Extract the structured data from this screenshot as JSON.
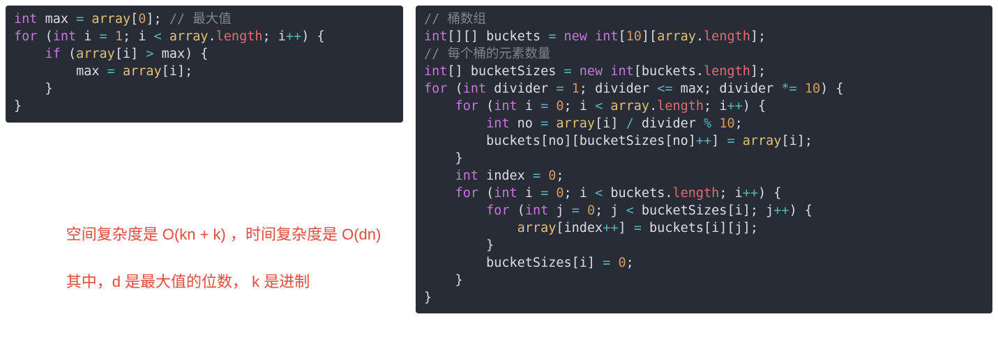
{
  "left_code": {
    "tokens": [
      [
        [
          "kw",
          "int "
        ],
        [
          "white",
          "max "
        ],
        [
          "op",
          "="
        ],
        [
          "white",
          " "
        ],
        [
          "call",
          "array"
        ],
        [
          "punc",
          "["
        ],
        [
          "num",
          "0"
        ],
        [
          "punc",
          "]; "
        ],
        [
          "cmt",
          "// 最大值"
        ]
      ],
      [
        [
          "kw",
          "for "
        ],
        [
          "punc",
          "("
        ],
        [
          "kw",
          "int "
        ],
        [
          "white",
          "i "
        ],
        [
          "op",
          "= "
        ],
        [
          "num",
          "1"
        ],
        [
          "punc",
          "; "
        ],
        [
          "white",
          "i "
        ],
        [
          "op",
          "< "
        ],
        [
          "call",
          "array"
        ],
        [
          "punc",
          "."
        ],
        [
          "prop",
          "length"
        ],
        [
          "punc",
          "; "
        ],
        [
          "white",
          "i"
        ],
        [
          "op",
          "++"
        ],
        [
          "punc",
          ") {"
        ]
      ],
      [
        [
          "punc",
          "    "
        ],
        [
          "kw",
          "if "
        ],
        [
          "punc",
          "("
        ],
        [
          "call",
          "array"
        ],
        [
          "punc",
          "["
        ],
        [
          "white",
          "i"
        ],
        [
          "punc",
          "] "
        ],
        [
          "op",
          ">"
        ],
        [
          "white",
          " max"
        ],
        [
          "punc",
          ") {"
        ]
      ],
      [
        [
          "punc",
          "        "
        ],
        [
          "white",
          "max "
        ],
        [
          "op",
          "="
        ],
        [
          "white",
          " "
        ],
        [
          "call",
          "array"
        ],
        [
          "punc",
          "["
        ],
        [
          "white",
          "i"
        ],
        [
          "punc",
          "];"
        ]
      ],
      [
        [
          "punc",
          "    }"
        ]
      ],
      [
        [
          "punc",
          "}"
        ]
      ]
    ]
  },
  "right_code": {
    "tokens": [
      [
        [
          "cmt",
          "// 桶数组"
        ]
      ],
      [
        [
          "kw",
          "int"
        ],
        [
          "punc",
          "[][] "
        ],
        [
          "white",
          "buckets "
        ],
        [
          "op",
          "= "
        ],
        [
          "newk",
          "new "
        ],
        [
          "kw",
          "int"
        ],
        [
          "punc",
          "["
        ],
        [
          "num",
          "10"
        ],
        [
          "punc",
          "]["
        ],
        [
          "call",
          "array"
        ],
        [
          "punc",
          "."
        ],
        [
          "prop",
          "length"
        ],
        [
          "punc",
          "];"
        ]
      ],
      [
        [
          "cmt",
          "// 每个桶的元素数量"
        ]
      ],
      [
        [
          "kw",
          "int"
        ],
        [
          "punc",
          "[] "
        ],
        [
          "white",
          "bucketSizes "
        ],
        [
          "op",
          "= "
        ],
        [
          "newk",
          "new "
        ],
        [
          "kw",
          "int"
        ],
        [
          "punc",
          "["
        ],
        [
          "white",
          "buckets"
        ],
        [
          "punc",
          "."
        ],
        [
          "prop",
          "length"
        ],
        [
          "punc",
          "];"
        ]
      ],
      [
        [
          "kw",
          "for "
        ],
        [
          "punc",
          "("
        ],
        [
          "kw",
          "int "
        ],
        [
          "white",
          "divider "
        ],
        [
          "op",
          "= "
        ],
        [
          "num",
          "1"
        ],
        [
          "punc",
          "; "
        ],
        [
          "white",
          "divider "
        ],
        [
          "op",
          "<= "
        ],
        [
          "white",
          "max"
        ],
        [
          "punc",
          "; "
        ],
        [
          "white",
          "divider "
        ],
        [
          "op",
          "*= "
        ],
        [
          "num",
          "10"
        ],
        [
          "punc",
          ") {"
        ]
      ],
      [
        [
          "punc",
          "    "
        ],
        [
          "kw",
          "for "
        ],
        [
          "punc",
          "("
        ],
        [
          "kw",
          "int "
        ],
        [
          "white",
          "i "
        ],
        [
          "op",
          "= "
        ],
        [
          "num",
          "0"
        ],
        [
          "punc",
          "; "
        ],
        [
          "white",
          "i "
        ],
        [
          "op",
          "< "
        ],
        [
          "call",
          "array"
        ],
        [
          "punc",
          "."
        ],
        [
          "prop",
          "length"
        ],
        [
          "punc",
          "; "
        ],
        [
          "white",
          "i"
        ],
        [
          "op",
          "++"
        ],
        [
          "punc",
          ") {"
        ]
      ],
      [
        [
          "punc",
          "        "
        ],
        [
          "kw",
          "int "
        ],
        [
          "white",
          "no "
        ],
        [
          "op",
          "= "
        ],
        [
          "call",
          "array"
        ],
        [
          "punc",
          "["
        ],
        [
          "white",
          "i"
        ],
        [
          "punc",
          "] "
        ],
        [
          "op",
          "/"
        ],
        [
          "white",
          " divider "
        ],
        [
          "op",
          "% "
        ],
        [
          "num",
          "10"
        ],
        [
          "punc",
          ";"
        ]
      ],
      [
        [
          "punc",
          "        "
        ],
        [
          "white",
          "buckets"
        ],
        [
          "punc",
          "["
        ],
        [
          "white",
          "no"
        ],
        [
          "punc",
          "]["
        ],
        [
          "white",
          "bucketSizes"
        ],
        [
          "punc",
          "["
        ],
        [
          "white",
          "no"
        ],
        [
          "punc",
          "]"
        ],
        [
          "op",
          "++"
        ],
        [
          "punc",
          "] "
        ],
        [
          "op",
          "= "
        ],
        [
          "call",
          "array"
        ],
        [
          "punc",
          "["
        ],
        [
          "white",
          "i"
        ],
        [
          "punc",
          "];"
        ]
      ],
      [
        [
          "punc",
          "    }"
        ]
      ],
      [
        [
          "punc",
          "    "
        ],
        [
          "kw",
          "int "
        ],
        [
          "white",
          "index "
        ],
        [
          "op",
          "= "
        ],
        [
          "num",
          "0"
        ],
        [
          "punc",
          ";"
        ]
      ],
      [
        [
          "punc",
          "    "
        ],
        [
          "kw",
          "for "
        ],
        [
          "punc",
          "("
        ],
        [
          "kw",
          "int "
        ],
        [
          "white",
          "i "
        ],
        [
          "op",
          "= "
        ],
        [
          "num",
          "0"
        ],
        [
          "punc",
          "; "
        ],
        [
          "white",
          "i "
        ],
        [
          "op",
          "< "
        ],
        [
          "white",
          "buckets"
        ],
        [
          "punc",
          "."
        ],
        [
          "prop",
          "length"
        ],
        [
          "punc",
          "; "
        ],
        [
          "white",
          "i"
        ],
        [
          "op",
          "++"
        ],
        [
          "punc",
          ") {"
        ]
      ],
      [
        [
          "punc",
          "        "
        ],
        [
          "kw",
          "for "
        ],
        [
          "punc",
          "("
        ],
        [
          "kw",
          "int "
        ],
        [
          "white",
          "j "
        ],
        [
          "op",
          "= "
        ],
        [
          "num",
          "0"
        ],
        [
          "punc",
          "; "
        ],
        [
          "white",
          "j "
        ],
        [
          "op",
          "< "
        ],
        [
          "white",
          "bucketSizes"
        ],
        [
          "punc",
          "["
        ],
        [
          "white",
          "i"
        ],
        [
          "punc",
          "]; "
        ],
        [
          "white",
          "j"
        ],
        [
          "op",
          "++"
        ],
        [
          "punc",
          ") {"
        ]
      ],
      [
        [
          "punc",
          "            "
        ],
        [
          "call",
          "array"
        ],
        [
          "punc",
          "["
        ],
        [
          "white",
          "index"
        ],
        [
          "op",
          "++"
        ],
        [
          "punc",
          "] "
        ],
        [
          "op",
          "= "
        ],
        [
          "white",
          "buckets"
        ],
        [
          "punc",
          "["
        ],
        [
          "white",
          "i"
        ],
        [
          "punc",
          "]["
        ],
        [
          "white",
          "j"
        ],
        [
          "punc",
          "];"
        ]
      ],
      [
        [
          "punc",
          "        }"
        ]
      ],
      [
        [
          "punc",
          "        "
        ],
        [
          "white",
          "bucketSizes"
        ],
        [
          "punc",
          "["
        ],
        [
          "white",
          "i"
        ],
        [
          "punc",
          "] "
        ],
        [
          "op",
          "= "
        ],
        [
          "num",
          "0"
        ],
        [
          "punc",
          ";"
        ]
      ],
      [
        [
          "punc",
          "    }"
        ]
      ],
      [
        [
          "punc",
          "}"
        ]
      ]
    ]
  },
  "note": {
    "line1": "空间复杂度是 O(kn + k) ，时间复杂度是 O(dn)",
    "line2": "其中，d 是最大值的位数， k 是进制"
  }
}
